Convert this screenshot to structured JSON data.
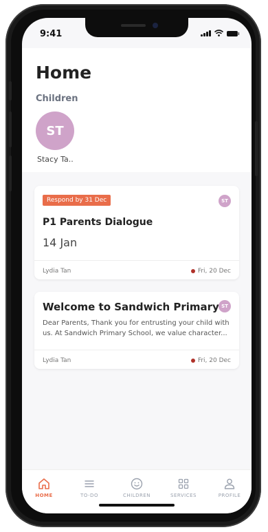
{
  "status_bar": {
    "time": "9:41"
  },
  "home": {
    "title": "Home",
    "children_label": "Children",
    "child": {
      "initials": "ST",
      "name": "Stacy Ta.."
    }
  },
  "cards": [
    {
      "badge": "Respond by 31 Dec",
      "avatar": "ST",
      "title": "P1 Parents Dialogue",
      "date": "14 Jan",
      "sender": "Lydia Tan",
      "timestamp": "Fri, 20 Dec",
      "unread": true
    },
    {
      "avatar": "ST",
      "title": "Welcome to Sandwich Primary",
      "body": "Dear Parents, Thank you for entrusting your child with us. At Sandwich Primary School, we value character...",
      "sender": "Lydia Tan",
      "timestamp": "Fri, 20 Dec",
      "unread": true
    }
  ],
  "tabs": [
    {
      "label": "HOME",
      "icon": "home-icon",
      "active": true
    },
    {
      "label": "TO-DO",
      "icon": "list-icon",
      "active": false
    },
    {
      "label": "CHILDREN",
      "icon": "smiley-icon",
      "active": false
    },
    {
      "label": "SERVICES",
      "icon": "grid-icon",
      "active": false
    },
    {
      "label": "PROFILE",
      "icon": "person-icon",
      "active": false
    }
  ],
  "colors": {
    "accent": "#e96d4a",
    "avatar": "#cfa3c9",
    "unread_dot": "#b0322a",
    "tab_inactive": "#9aa1ad"
  }
}
